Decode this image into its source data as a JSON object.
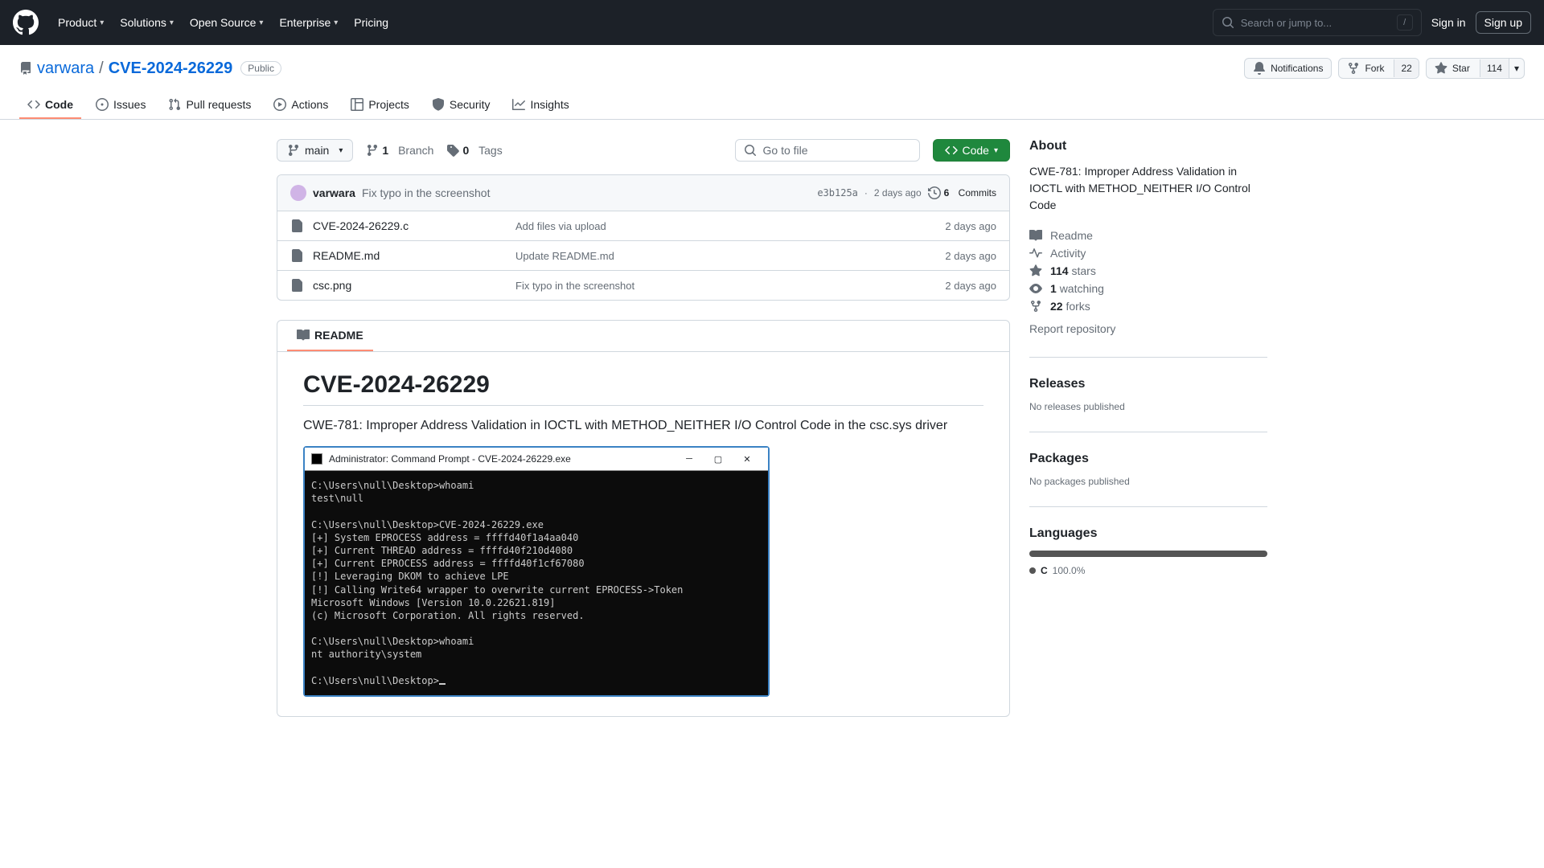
{
  "header": {
    "nav": [
      "Product",
      "Solutions",
      "Open Source",
      "Enterprise"
    ],
    "pricing": "Pricing",
    "search_placeholder": "Search or jump to...",
    "slash": "/",
    "signin": "Sign in",
    "signup": "Sign up"
  },
  "repo": {
    "owner": "varwara",
    "name": "CVE-2024-26229",
    "visibility": "Public",
    "notifications": "Notifications",
    "fork": "Fork",
    "fork_count": "22",
    "star": "Star",
    "star_count": "114"
  },
  "tabs": {
    "code": "Code",
    "issues": "Issues",
    "pulls": "Pull requests",
    "actions": "Actions",
    "projects": "Projects",
    "security": "Security",
    "insights": "Insights"
  },
  "branch": {
    "current": "main",
    "branches_count": "1",
    "branches_label": "Branch",
    "tags_count": "0",
    "tags_label": "Tags",
    "gotofile_placeholder": "Go to file",
    "code_label": "Code"
  },
  "commit": {
    "author": "varwara",
    "message": "Fix typo in the screenshot",
    "sha": "e3b125a",
    "time": "2 days ago",
    "commits_count": "6",
    "commits_label": "Commits"
  },
  "files": [
    {
      "name": "CVE-2024-26229.c",
      "msg": "Add files via upload",
      "time": "2 days ago"
    },
    {
      "name": "README.md",
      "msg": "Update README.md",
      "time": "2 days ago"
    },
    {
      "name": "csc.png",
      "msg": "Fix typo in the screenshot",
      "time": "2 days ago"
    }
  ],
  "readme": {
    "tab": "README",
    "title": "CVE-2024-26229",
    "intro": "CWE-781: Improper Address Validation in IOCTL with METHOD_NEITHER I/O Control Code in the csc.sys driver",
    "cmd_title": "Administrator: Command Prompt - CVE-2024-26229.exe",
    "cmd_lines": "C:\\Users\\null\\Desktop>whoami\ntest\\null\n\nC:\\Users\\null\\Desktop>CVE-2024-26229.exe\n[+] System EPROCESS address = ffffd40f1a4aa040\n[+] Current THREAD address = ffffd40f210d4080\n[+] Current EPROCESS address = ffffd40f1cf67080\n[!] Leveraging DKOM to achieve LPE\n[!] Calling Write64 wrapper to overwrite current EPROCESS->Token\nMicrosoft Windows [Version 10.0.22621.819]\n(c) Microsoft Corporation. All rights reserved.\n\nC:\\Users\\null\\Desktop>whoami\nnt authority\\system\n\nC:\\Users\\null\\Desktop>"
  },
  "sidebar": {
    "about": "About",
    "description": "CWE-781: Improper Address Validation in IOCTL with METHOD_NEITHER I/O Control Code",
    "readme": "Readme",
    "activity": "Activity",
    "stars_n": "114",
    "stars_label": "stars",
    "watch_n": "1",
    "watch_label": "watching",
    "forks_n": "22",
    "forks_label": "forks",
    "report": "Report repository",
    "releases": "Releases",
    "releases_none": "No releases published",
    "packages": "Packages",
    "packages_none": "No packages published",
    "languages": "Languages",
    "lang_name": "C",
    "lang_pct": "100.0%"
  }
}
